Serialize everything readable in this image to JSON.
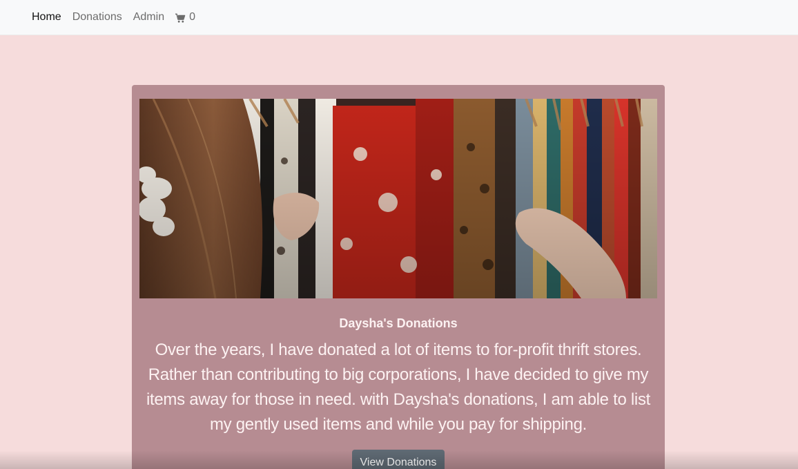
{
  "navbar": {
    "links": [
      {
        "label": "Home",
        "active": true
      },
      {
        "label": "Donations",
        "active": false
      },
      {
        "label": "Admin",
        "active": false
      }
    ],
    "cart": {
      "icon": "cart-icon",
      "count": "0"
    }
  },
  "card": {
    "image": {
      "icon": "clothing-rack-photo"
    },
    "title": "Daysha's Donations",
    "text": "Over the years, I have donated a lot of items to for-profit thrift stores. Rather than contributing to big corporations, I have decided to give my items away for those in need. with Daysha's donations, I am able to list my gently used items and while you pay for shipping.",
    "button_label": "View Donations"
  },
  "colors": {
    "page_background": "#f6dcdc",
    "card_background": "#b68c92",
    "navbar_background": "#f8f9fa",
    "button_background": "#5f6a74"
  }
}
